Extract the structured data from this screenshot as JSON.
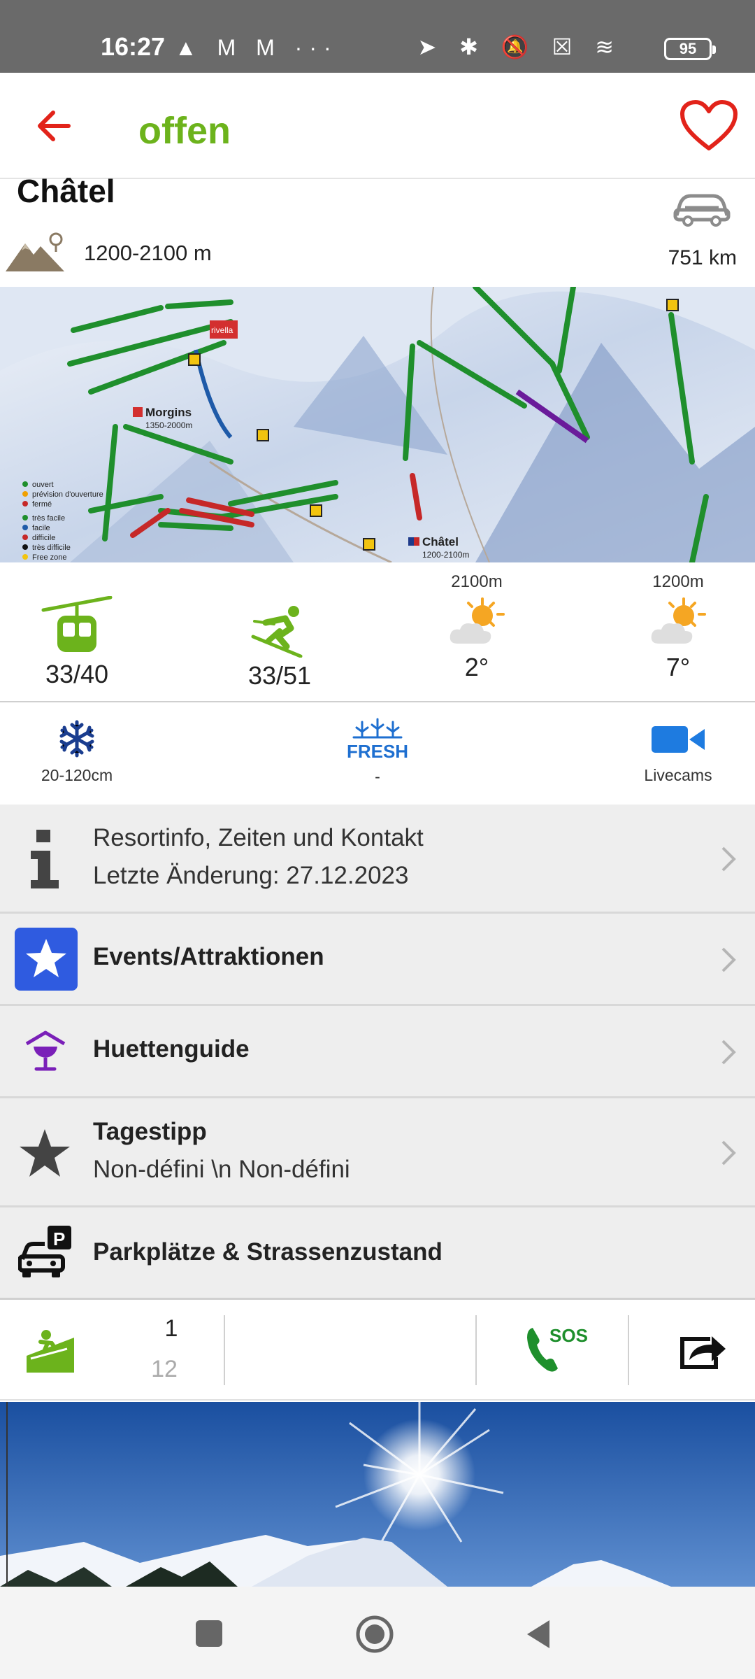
{
  "status_bar": {
    "time": "16:27",
    "left_icons": "▲ M M ···",
    "right_icons": "➤ ✱ 🔕 ☒ ≋",
    "battery": "95"
  },
  "app_bar": {
    "title": "offen",
    "title_color": "#6cb31c",
    "back_icon": "arrow-left-icon",
    "favorite_icon": "heart-outline-icon"
  },
  "resort": {
    "name": "Châtel",
    "altitude": "1200-2100 m",
    "distance": "751 km"
  },
  "trail_map": {
    "labels": {
      "morgins": "Morgins",
      "morgins_alt": "1350-2000m",
      "chatel": "Châtel",
      "chatel_alt": "1200-2100m",
      "rivella": "rivella"
    },
    "legend": [
      "ouvert",
      "prévision d'ouverture",
      "fermé",
      "très facile",
      "facile",
      "difficile",
      "très difficile",
      "Free zone"
    ]
  },
  "stats": {
    "lifts": "33/40",
    "slopes": "33/51",
    "weather_top_alt": "2100m",
    "weather_top_temp": "2°",
    "weather_bottom_alt": "1200m",
    "weather_bottom_temp": "7°"
  },
  "stats2": {
    "snow_depth": "20-120cm",
    "fresh_badge": "FRESH",
    "fresh_value": "-",
    "livecams": "Livecams"
  },
  "menu": {
    "info_line1": "Resortinfo, Zeiten und Kontakt",
    "info_line2": "Letzte Änderung: 27.12.2023",
    "events": "Events/Attraktionen",
    "huts": "Huettenguide",
    "tip_title": "Tagestipp",
    "tip_value": "Non-défini \\n Non-défini",
    "parking": "Parkplätze & Strassenzustand"
  },
  "footer": {
    "count_top": "1",
    "count_bottom": "12",
    "sos_label": "SOS"
  }
}
